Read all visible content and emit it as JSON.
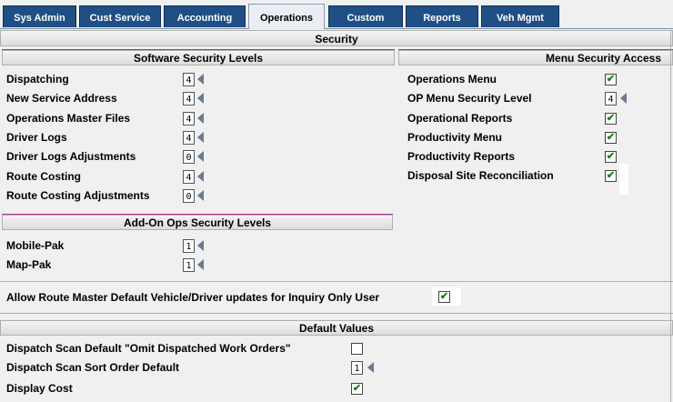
{
  "tabs": [
    {
      "label": "Sys Admin",
      "active": false
    },
    {
      "label": "Cust Service",
      "active": false
    },
    {
      "label": "Accounting",
      "active": false
    },
    {
      "label": "Operations",
      "active": true
    },
    {
      "label": "Custom",
      "active": false
    },
    {
      "label": "Reports",
      "active": false
    },
    {
      "label": "Veh Mgmt",
      "active": false
    }
  ],
  "title": "Security",
  "software": {
    "header": "Software Security Levels",
    "rows": [
      {
        "label": "Dispatching",
        "value": "4"
      },
      {
        "label": "New Service Address",
        "value": "4"
      },
      {
        "label": "Operations Master Files",
        "value": "4"
      },
      {
        "label": "Driver Logs",
        "value": "4"
      },
      {
        "label": "Driver Logs Adjustments",
        "value": "0"
      },
      {
        "label": "Route Costing",
        "value": "4"
      },
      {
        "label": "Route Costing Adjustments",
        "value": "0"
      }
    ]
  },
  "menu": {
    "header": "Menu Security Access",
    "rows": [
      {
        "label": "Operations Menu",
        "checked": true
      },
      {
        "label": "OP Menu Security Level",
        "value": "4"
      },
      {
        "label": "Operational Reports",
        "checked": true
      },
      {
        "label": "Productivity Menu",
        "checked": true
      },
      {
        "label": "Productivity Reports",
        "checked": true
      },
      {
        "label": "Disposal Site Reconciliation",
        "checked": true
      }
    ]
  },
  "addon": {
    "header": "Add-On Ops Security Levels",
    "rows": [
      {
        "label": "Mobile-Pak",
        "value": "1"
      },
      {
        "label": "Map-Pak",
        "value": "1"
      }
    ]
  },
  "route_master": {
    "label": "Allow Route Master Default Vehicle/Driver updates for Inquiry Only User",
    "checked": true
  },
  "defaults": {
    "header": "Default Values",
    "omit_label": "Dispatch Scan Default \"Omit Dispatched Work Orders\"",
    "omit_checked": false,
    "sort_label": "Dispatch Scan Sort Order Default",
    "sort_value": "1",
    "cost_label": "Display Cost",
    "cost_checked": true
  },
  "check_glyph": "✔",
  "colors": {
    "tab_bg": "#1f4f85",
    "accent_line": "#b0309a",
    "check": "#1a7a1a"
  }
}
